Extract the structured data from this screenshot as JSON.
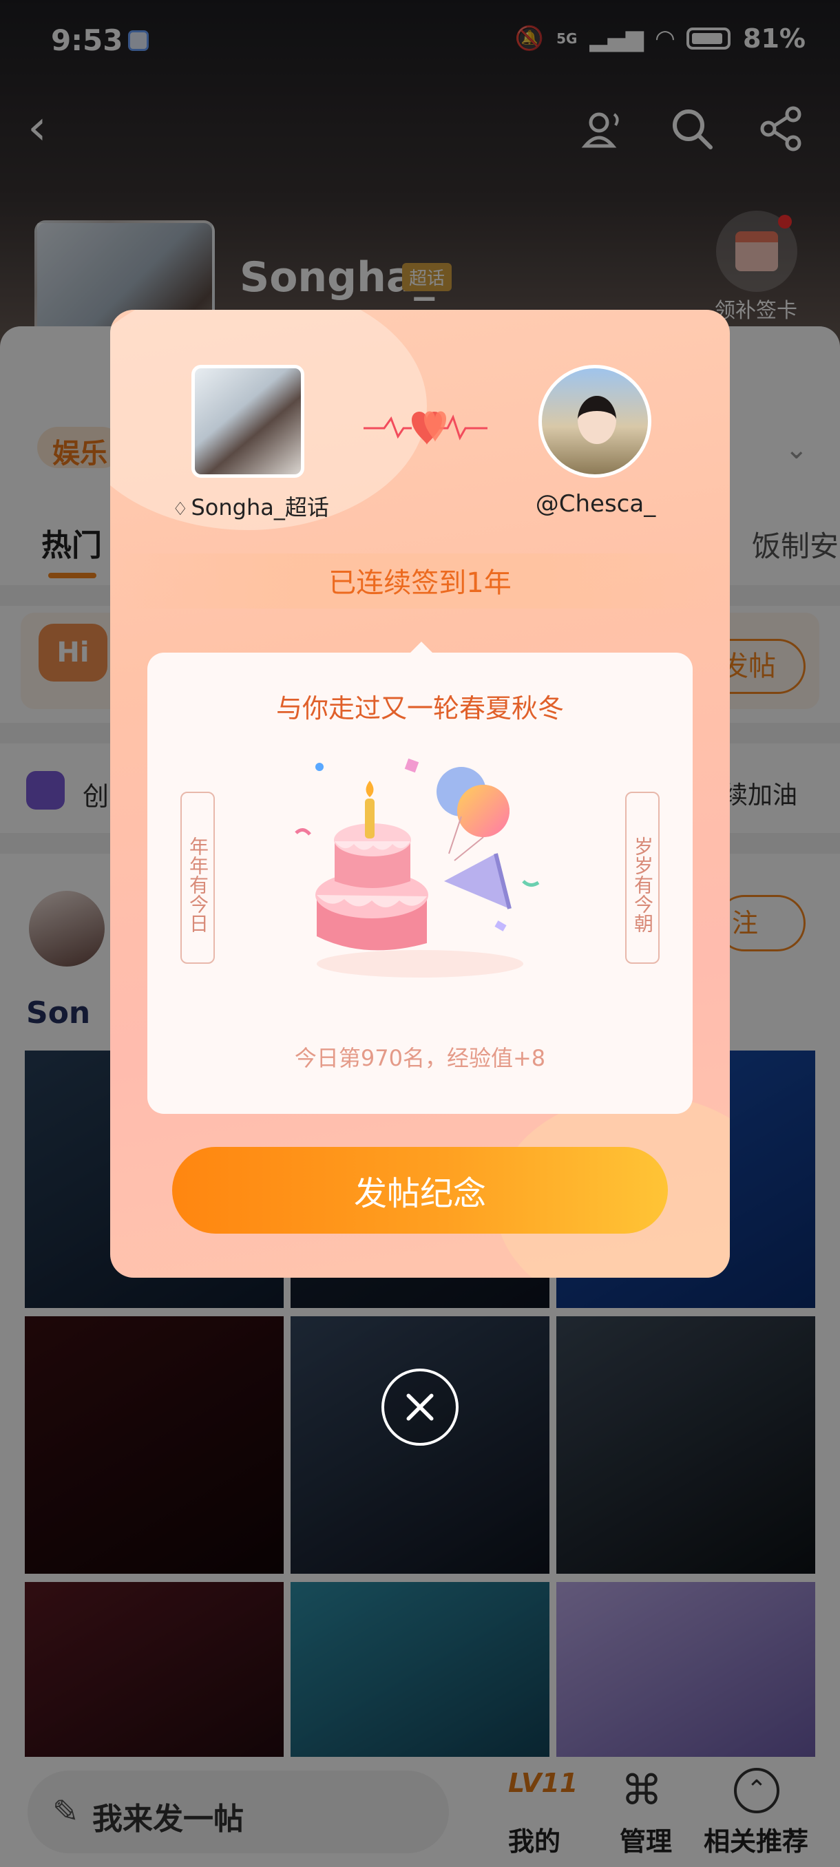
{
  "status_bar": {
    "time": "9:53",
    "battery": "81%",
    "network": "5G"
  },
  "header": {
    "topic_name": "Songha_",
    "topic_tag": "超话",
    "signin_card_label": "领补签卡"
  },
  "background": {
    "category_pill": "娱乐",
    "tab_hot": "热门",
    "tab_right": "饭制安",
    "post_button": "发帖",
    "create_label": "创",
    "continue_label": "续加油",
    "follow_button": "注",
    "section_label": "Son",
    "hi_badge": "Hi"
  },
  "dialog": {
    "topic_name": "Songha_超话",
    "user_name": "@Chesca_",
    "streak_text": "已连续签到1年",
    "card_title": "与你走过又一轮春夏秋冬",
    "left_scroll": "年年有今日",
    "right_scroll": "岁岁有今朝",
    "rank_text": "今日第970名，经验值+8",
    "button_label": "发帖纪念"
  },
  "bottom_bar": {
    "compose_label": "我来发一帖",
    "level_badge": "LV11",
    "tabs": [
      {
        "label": "我的",
        "icon": "level-icon"
      },
      {
        "label": "管理",
        "icon": "grid-icon"
      },
      {
        "label": "相关推荐",
        "icon": "up-circle-icon"
      }
    ]
  },
  "colors": {
    "accent": "#f5871f",
    "button_start": "#ff8610",
    "button_end": "#ffc436",
    "streak_text": "#ec6a1f"
  }
}
